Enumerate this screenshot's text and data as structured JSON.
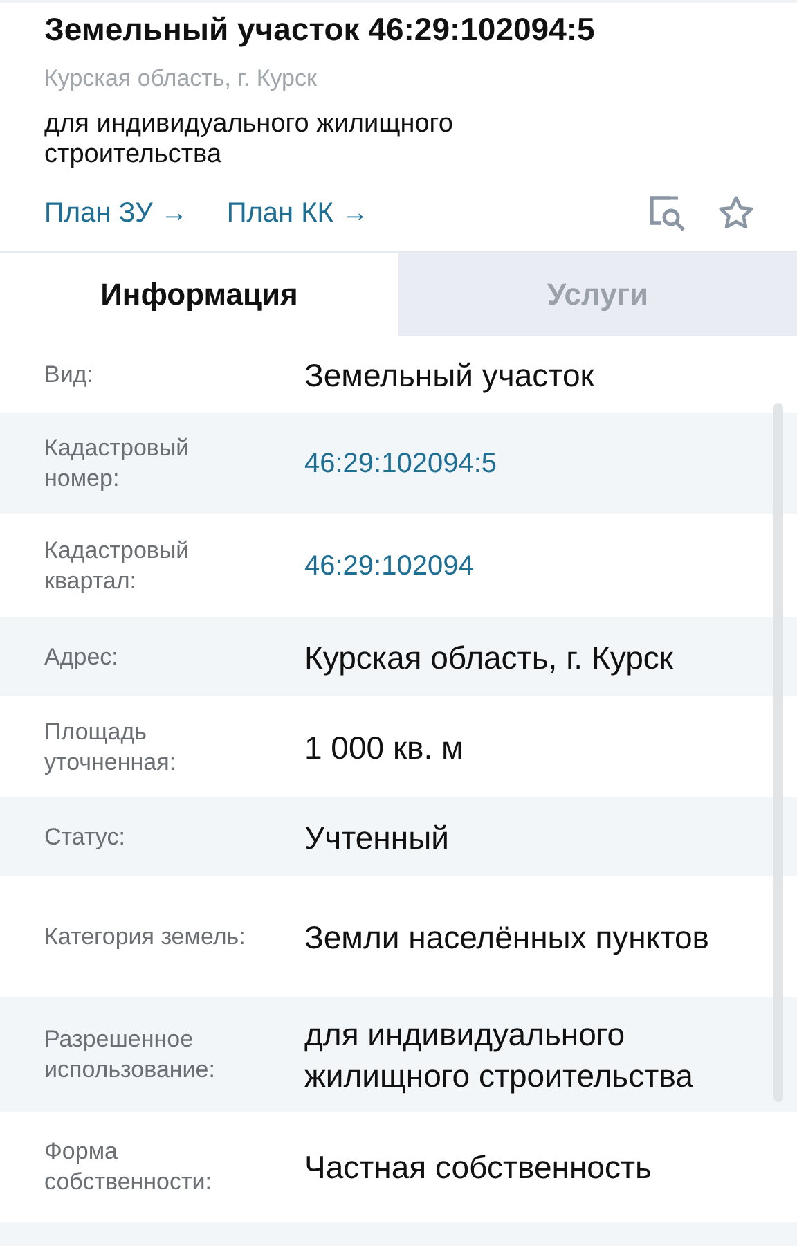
{
  "header": {
    "title": "Земельный участок 46:29:102094:5",
    "address": "Курская область, г. Курск",
    "purpose": "для индивидуального жилищного строительства",
    "links": [
      {
        "label": "План ЗУ →"
      },
      {
        "label": "План КК →"
      }
    ]
  },
  "tabs": [
    {
      "label": "Информация",
      "selected": true
    },
    {
      "label": "Услуги",
      "selected": false
    }
  ],
  "rows": [
    {
      "label": "Вид:",
      "value": "Земельный участок",
      "kind": "text"
    },
    {
      "label": "Кадастровый номер:",
      "value": "46:29:102094:5",
      "kind": "link"
    },
    {
      "label": "Кадастровый квартал:",
      "value": "46:29:102094",
      "kind": "link"
    },
    {
      "label": "Адрес:",
      "value": "Курская область, г. Курск",
      "kind": "text"
    },
    {
      "label": "Площадь уточненная:",
      "value": "1 000 кв. м",
      "kind": "text"
    },
    {
      "label": "Статус:",
      "value": "Учтенный",
      "kind": "text"
    },
    {
      "label": "Категория земель:",
      "value": "Земли населённых пунктов",
      "kind": "text"
    },
    {
      "label": "Разрешенное использование:",
      "value": "для индивидуального жилищного строительства",
      "kind": "text"
    },
    {
      "label": "Форма собственности:",
      "value": "Частная собственность",
      "kind": "text"
    }
  ]
}
